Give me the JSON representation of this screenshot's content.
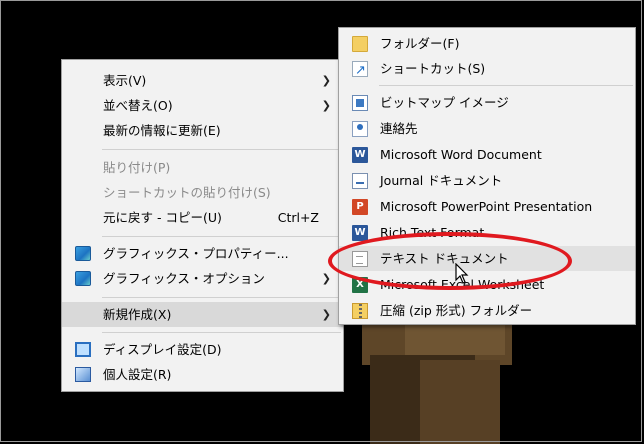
{
  "context_menu": {
    "items": [
      {
        "label": "表示(V)",
        "submenu": true
      },
      {
        "label": "並べ替え(O)",
        "submenu": true
      },
      {
        "label": "最新の情報に更新(E)"
      },
      {
        "label": "貼り付け(P)",
        "disabled": true
      },
      {
        "label": "ショートカットの貼り付け(S)",
        "disabled": true
      },
      {
        "label": "元に戻す - コピー(U)",
        "shortcut": "Ctrl+Z"
      },
      {
        "label": "グラフィックス・プロパティー...",
        "icon": "graphics-icon"
      },
      {
        "label": "グラフィックス・オプション",
        "icon": "graphics-icon",
        "submenu": true
      },
      {
        "label": "新規作成(X)",
        "submenu": true,
        "highlighted": true
      },
      {
        "label": "ディスプレイ設定(D)",
        "icon": "display-icon"
      },
      {
        "label": "個人設定(R)",
        "icon": "personalize-icon"
      }
    ]
  },
  "new_submenu": {
    "items": [
      {
        "label": "フォルダー(F)",
        "icon": "folder-icon"
      },
      {
        "label": "ショートカット(S)",
        "icon": "shortcut-icon"
      },
      {
        "label": "ビットマップ イメージ",
        "icon": "bitmap-icon"
      },
      {
        "label": "連絡先",
        "icon": "contact-icon"
      },
      {
        "label": "Microsoft Word Document",
        "icon": "word-icon",
        "glyph": "W"
      },
      {
        "label": "Journal ドキュメント",
        "icon": "journal-icon"
      },
      {
        "label": "Microsoft PowerPoint Presentation",
        "icon": "powerpoint-icon",
        "glyph": "P"
      },
      {
        "label": "Rich Text Format",
        "icon": "rtf-icon",
        "glyph": "W"
      },
      {
        "label": "テキスト ドキュメント",
        "icon": "text-document-icon",
        "highlighted": true
      },
      {
        "label": "Microsoft Excel Worksheet",
        "icon": "excel-icon",
        "glyph": "X"
      },
      {
        "label": "圧縮 (zip 形式) フォルダー",
        "icon": "zip-folder-icon"
      }
    ]
  },
  "annotation": {
    "color": "#e0191f",
    "shape": "ellipse"
  },
  "colors": {
    "menu_bg": "#f2f2f2",
    "highlight": "#d9d9d9",
    "disabled_text": "#8a8a8a"
  }
}
